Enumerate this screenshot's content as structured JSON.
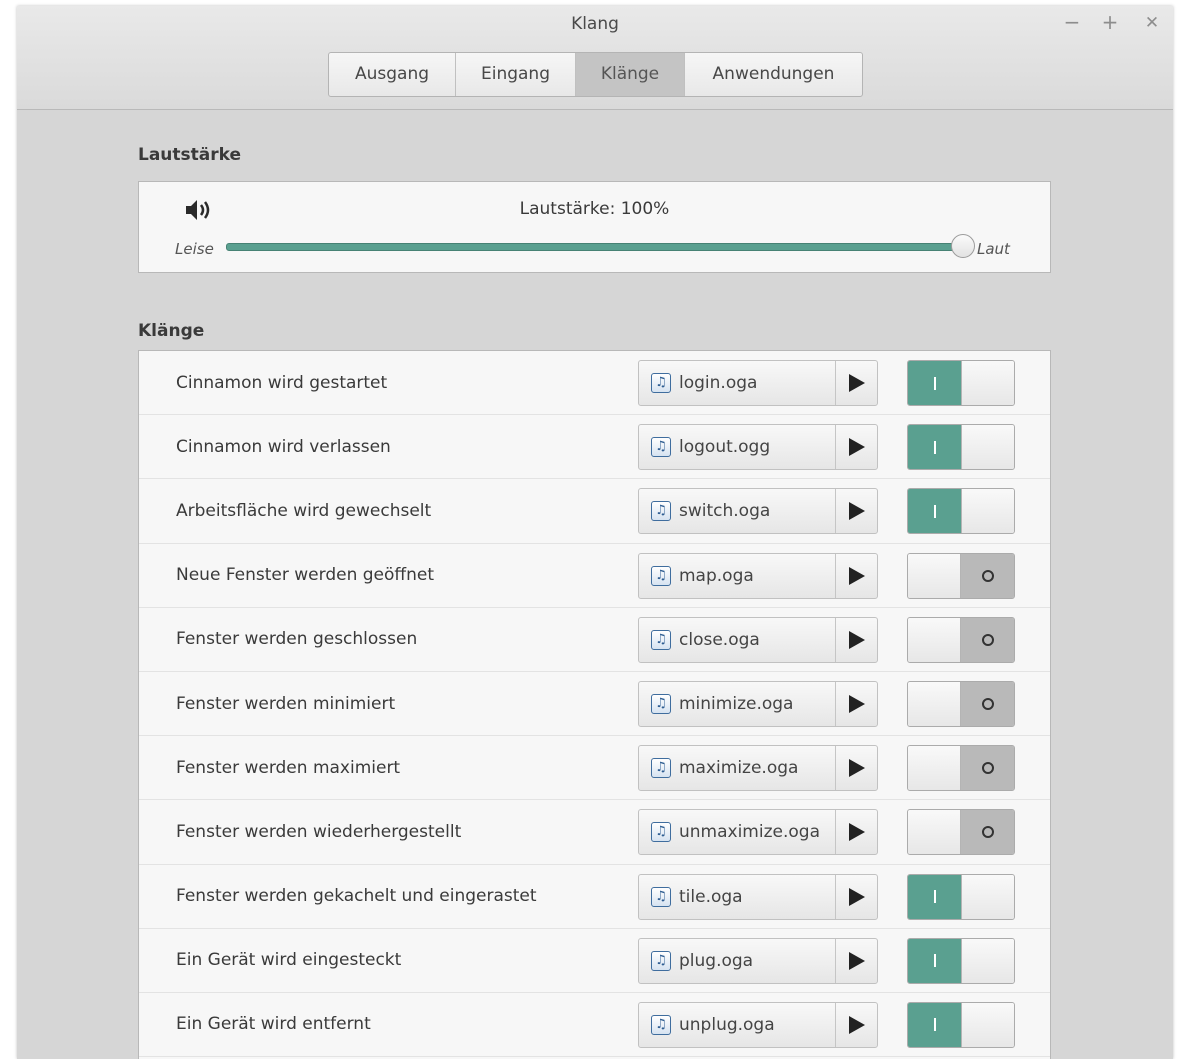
{
  "window": {
    "title": "Klang",
    "controls": {
      "minimize": "−",
      "maximize": "+",
      "close": "✕"
    }
  },
  "tabs": [
    {
      "label": "Ausgang",
      "active": false
    },
    {
      "label": "Eingang",
      "active": false
    },
    {
      "label": "Klänge",
      "active": true
    },
    {
      "label": "Anwendungen",
      "active": false
    }
  ],
  "volume": {
    "section_title": "Lautstärke",
    "label": "Lautstärke: 100%",
    "level_percent": 100,
    "min_label": "Leise",
    "max_label": "Laut",
    "icon": "speaker-icon"
  },
  "sounds": {
    "section_title": "Klänge",
    "items": [
      {
        "label": "Cinnamon wird gestartet",
        "file": "login.oga",
        "enabled": true
      },
      {
        "label": "Cinnamon wird verlassen",
        "file": "logout.ogg",
        "enabled": true
      },
      {
        "label": "Arbeitsfläche wird gewechselt",
        "file": "switch.oga",
        "enabled": true
      },
      {
        "label": "Neue Fenster werden geöffnet",
        "file": "map.oga",
        "enabled": false
      },
      {
        "label": "Fenster werden geschlossen",
        "file": "close.oga",
        "enabled": false
      },
      {
        "label": "Fenster werden minimiert",
        "file": "minimize.oga",
        "enabled": false
      },
      {
        "label": "Fenster werden maximiert",
        "file": "maximize.oga",
        "enabled": false
      },
      {
        "label": "Fenster werden wiederhergestellt",
        "file": "unmaximize.oga",
        "enabled": false
      },
      {
        "label": "Fenster werden gekachelt und eingerastet",
        "file": "tile.oga",
        "enabled": true
      },
      {
        "label": "Ein Gerät wird eingesteckt",
        "file": "plug.oga",
        "enabled": true
      },
      {
        "label": "Ein Gerät wird entfernt",
        "file": "unplug.oga",
        "enabled": true
      }
    ]
  },
  "colors": {
    "accent": "#5aa090",
    "window_bg": "#d6d6d6",
    "panel_bg": "#f7f7f7"
  }
}
